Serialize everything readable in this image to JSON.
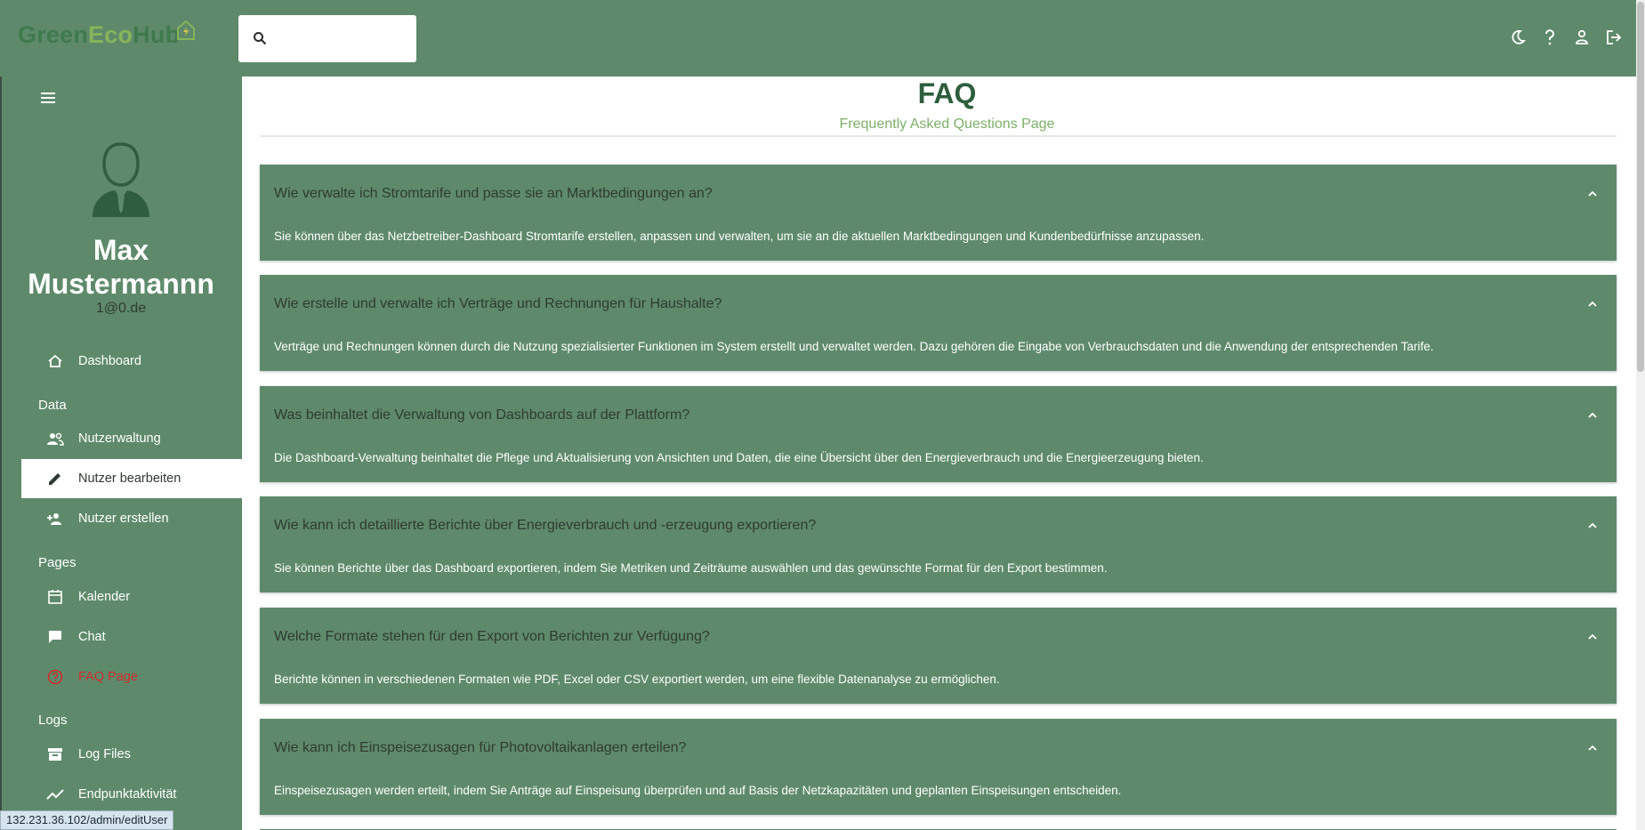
{
  "colors": {
    "accent": "#5e8a6b",
    "title": "#2e5e3e",
    "subtitle": "#7caf6a",
    "danger": "#c9302c"
  },
  "brand": {
    "part1": "Green",
    "part2": "Eco",
    "part3": "Hub"
  },
  "search": {
    "placeholder": ""
  },
  "top_icons": [
    "moon-icon",
    "help-icon",
    "person-icon",
    "logout-icon"
  ],
  "user": {
    "first_name": "Max",
    "last_name": "Mustermannn",
    "email": "1@0.de"
  },
  "sidebar": {
    "dashboard": "Dashboard",
    "sections": {
      "data": "Data",
      "pages": "Pages",
      "logs": "Logs"
    },
    "items": {
      "nutzerwaltung": "Nutzerwaltung",
      "nutzer_bearbeiten": "Nutzer bearbeiten",
      "nutzer_erstellen": "Nutzer erstellen",
      "kalender": "Kalender",
      "chat": "Chat",
      "faq": "FAQ Page",
      "log_files": "Log Files",
      "endpunkt": "Endpunktaktivität"
    }
  },
  "status_url": "132.231.36.102/admin/editUser",
  "page": {
    "title": "FAQ",
    "subtitle": "Frequently Asked Questions Page"
  },
  "faqs": [
    {
      "q": "Wie verwalte ich Stromtarife und passe sie an Marktbedingungen an?",
      "a": "Sie können über das Netzbetreiber-Dashboard Stromtarife erstellen, anpassen und verwalten, um sie an die aktuellen Marktbedingungen und Kundenbedürfnisse anzupassen."
    },
    {
      "q": "Wie erstelle und verwalte ich Verträge und Rechnungen für Haushalte?",
      "a": "Verträge und Rechnungen können durch die Nutzung spezialisierter Funktionen im System erstellt und verwaltet werden. Dazu gehören die Eingabe von Verbrauchsdaten und die Anwendung der entsprechenden Tarife."
    },
    {
      "q": "Was beinhaltet die Verwaltung von Dashboards auf der Plattform?",
      "a": "Die Dashboard-Verwaltung beinhaltet die Pflege und Aktualisierung von Ansichten und Daten, die eine Übersicht über den Energieverbrauch und die Energieerzeugung bieten."
    },
    {
      "q": "Wie kann ich detaillierte Berichte über Energieverbrauch und -erzeugung exportieren?",
      "a": "Sie können Berichte über das Dashboard exportieren, indem Sie Metriken und Zeiträume auswählen und das gewünschte Format für den Export bestimmen."
    },
    {
      "q": "Welche Formate stehen für den Export von Berichten zur Verfügung?",
      "a": "Berichte können in verschiedenen Formaten wie PDF, Excel oder CSV exportiert werden, um eine flexible Datenanalyse zu ermöglichen."
    },
    {
      "q": "Wie kann ich Einspeisezusagen für Photovoltaikanlagen erteilen?",
      "a": "Einspeisezusagen werden erteilt, indem Sie Anträge auf Einspeisung überprüfen und auf Basis der Netzkapazitäten und geplanten Einspeisungen entscheiden."
    }
  ]
}
